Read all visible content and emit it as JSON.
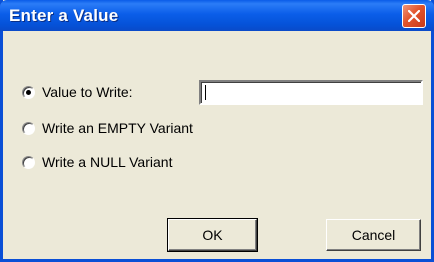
{
  "window": {
    "title": "Enter a Value",
    "accent": "#0a5ce8",
    "close_icon": "close-icon"
  },
  "options": [
    {
      "label": "Value to Write:",
      "selected": true
    },
    {
      "label": "Write an EMPTY Variant",
      "selected": false
    },
    {
      "label": "Write a NULL Variant",
      "selected": false
    }
  ],
  "value_input": {
    "value": "",
    "placeholder": ""
  },
  "buttons": {
    "ok": "OK",
    "cancel": "Cancel"
  }
}
